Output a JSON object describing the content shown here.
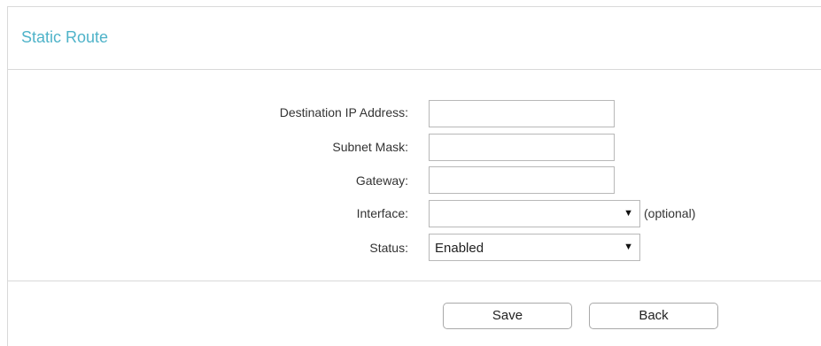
{
  "page": {
    "title": "Static Route"
  },
  "form": {
    "destination_ip": {
      "label": "Destination IP Address:",
      "value": ""
    },
    "subnet_mask": {
      "label": "Subnet Mask:",
      "value": ""
    },
    "gateway": {
      "label": "Gateway:",
      "value": ""
    },
    "interface": {
      "label": "Interface:",
      "selected": "",
      "hint": "(optional)"
    },
    "status": {
      "label": "Status:",
      "selected": "Enabled"
    }
  },
  "actions": {
    "save_label": "Save",
    "back_label": "Back"
  },
  "colors": {
    "title": "#4fb3c9",
    "border": "#d9d9d9",
    "input_border": "#b8b8b8"
  },
  "icons": {
    "dropdown": "chevron-down-icon"
  }
}
